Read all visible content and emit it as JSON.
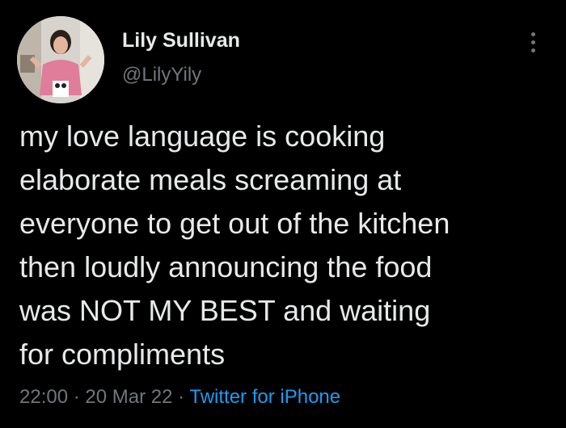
{
  "user": {
    "display_name": "Lily Sullivan",
    "handle": "@LilyYily",
    "avatar_icon": "profile-photo"
  },
  "tweet": {
    "lines": [
      "my love language is cooking",
      "elaborate meals screaming at",
      "everyone to get out of the kitchen",
      "then loudly announcing the food",
      "was NOT MY BEST and waiting",
      "for compliments"
    ]
  },
  "meta": {
    "time": "22:00",
    "separator": "·",
    "date": "20 Mar 22",
    "source": "Twitter for iPhone"
  },
  "menu": {
    "icon": "more-vertical-icon"
  },
  "colors": {
    "background": "#000000",
    "text": "#e7e9ea",
    "muted": "#71767b",
    "link": "#1d9bf0"
  }
}
